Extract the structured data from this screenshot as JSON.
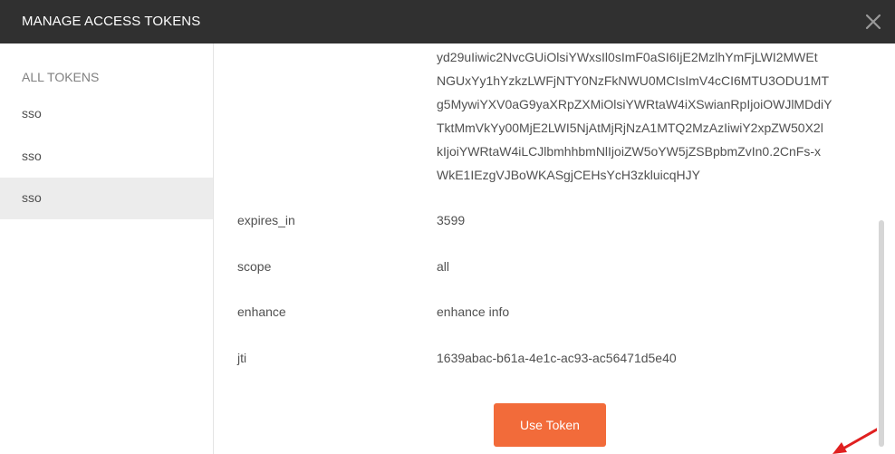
{
  "header": {
    "title": "MANAGE ACCESS TOKENS"
  },
  "icons": {
    "close": "close-icon"
  },
  "sidebar": {
    "heading": "ALL TOKENS",
    "items": [
      {
        "label": "sso",
        "selected": false
      },
      {
        "label": "sso",
        "selected": false
      },
      {
        "label": "sso",
        "selected": true
      }
    ]
  },
  "token": {
    "access_token_lines": [
      "yd29uIiwic2NvcGUiOlsiYWxsIl0sImF0aSI6IjE2MzlhYmFjLWI2MWEt",
      "NGUxYy1hYzkzLWFjNTY0NzFkNWU0MCIsImV4cCI6MTU3ODU1MT",
      "g5MywiYXV0aG9yaXRpZXMiOlsiYWRtaW4iXSwianRpIjoiOWJlMDdiY",
      "TktMmVkYy00MjE2LWI5NjAtMjRjNzA1MTQ2MzAzIiwiY2xpZW50X2l",
      "kIjoiYWRtaW4iLCJlbmhhbmNlIjoiZW5oYW5jZSBpbmZvIn0.2CnFs-x",
      "WkE1IEzgVJBoWKASgjCEHsYcH3zkluicqHJY"
    ],
    "rows": [
      {
        "key": "expires_in",
        "value": "3599"
      },
      {
        "key": "scope",
        "value": "all"
      },
      {
        "key": "enhance",
        "value": "enhance info"
      },
      {
        "key": "jti",
        "value": "1639abac-b61a-4e1c-ac93-ac56471d5e40"
      }
    ]
  },
  "actions": {
    "use_token_label": "Use Token"
  },
  "colors": {
    "header_bg": "#303030",
    "accent": "#f26b3a",
    "annotation_arrow": "#e02020"
  }
}
